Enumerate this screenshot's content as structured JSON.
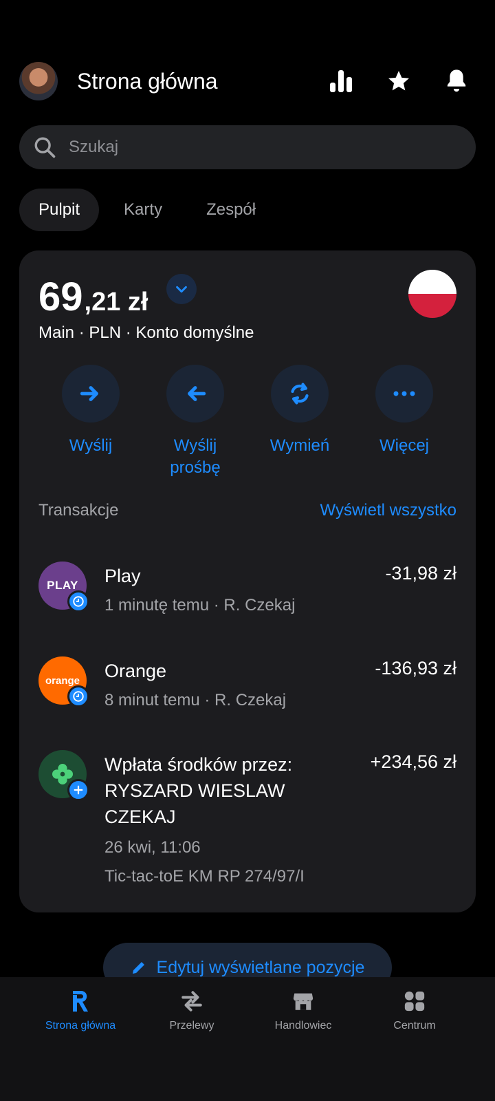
{
  "header": {
    "title": "Strona główna",
    "icons": [
      "avatar",
      "stats-icon",
      "star-icon",
      "bell-icon"
    ]
  },
  "search": {
    "placeholder": "Szukaj"
  },
  "tabs": [
    {
      "label": "Pulpit",
      "active": true
    },
    {
      "label": "Karty",
      "active": false
    },
    {
      "label": "Zespół",
      "active": false
    }
  ],
  "account": {
    "balance_int": "69",
    "balance_dec": ",21 zł",
    "subtitle": "Main · PLN · Konto domyślne",
    "flag": "poland-flag"
  },
  "actions": [
    {
      "label": "Wyślij",
      "icon": "arrow-right-icon"
    },
    {
      "label": "Wyślij prośbę",
      "icon": "arrow-left-icon"
    },
    {
      "label": "Wymień",
      "icon": "exchange-icon"
    },
    {
      "label": "Więcej",
      "icon": "more-icon"
    }
  ],
  "transactions": {
    "title": "Transakcje",
    "view_all": "Wyświetl wszystko",
    "items": [
      {
        "name": "Play",
        "amount": "-31,98 zł",
        "sub1": "1 minutę temu · R. Czekaj",
        "logo": "PLAY",
        "logo_color": "#6b3f8c",
        "badge": "clock-icon"
      },
      {
        "name": "Orange",
        "amount": "-136,93 zł",
        "sub1": "8 minut temu · R. Czekaj",
        "logo": "orange",
        "logo_color": "#ff6a00",
        "badge": "clock-icon"
      },
      {
        "name": "Wpłata środków przez: RYSZARD WIESLAW CZEKAJ",
        "amount": "+234,56 zł",
        "sub1": "26 kwi, 11:06",
        "sub2": "Tic-tac-toE KM RP 274/97/I",
        "logo_color": "#1d4d33",
        "badge": "plus-icon"
      }
    ]
  },
  "edit_button": {
    "label": "Edytuj wyświetlane pozycje"
  },
  "bottom_nav": [
    {
      "label": "Strona główna",
      "active": true
    },
    {
      "label": "Przelewy",
      "active": false
    },
    {
      "label": "Handlowiec",
      "active": false
    },
    {
      "label": "Centrum",
      "active": false
    }
  ],
  "colors": {
    "accent": "#1e8cff",
    "card": "#1c1c1f",
    "background": "#000000"
  }
}
